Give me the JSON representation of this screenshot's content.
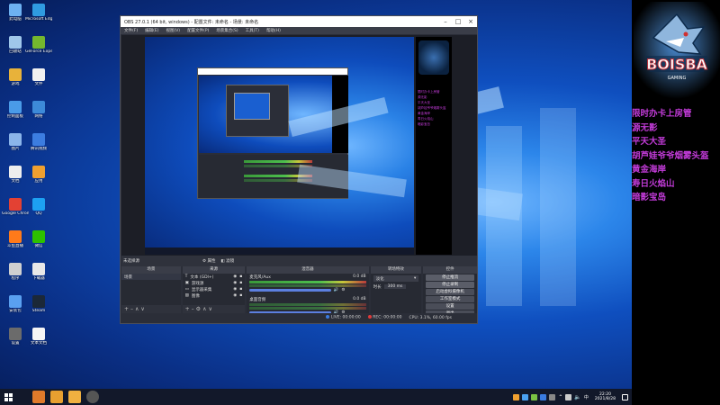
{
  "desktop": {
    "icons": [
      {
        "label": "此电脑",
        "color": "#6db1f2"
      },
      {
        "label": "Microsoft Edge",
        "color": "#2f9be0"
      },
      {
        "label": "回收站",
        "color": "#9fc7ea"
      },
      {
        "label": "GeForce Experience",
        "color": "#74b72e"
      },
      {
        "label": "游戏",
        "color": "#e8b23a"
      },
      {
        "label": "文件",
        "color": "#f1f1f1"
      },
      {
        "label": "控制面板",
        "color": "#4a9be8"
      },
      {
        "label": "网络",
        "color": "#3d8ad8"
      },
      {
        "label": "图片",
        "color": "#8bb5ea"
      },
      {
        "label": "腾讯视频",
        "color": "#3c7de0"
      },
      {
        "label": "文档",
        "color": "#eeeeee"
      },
      {
        "label": "应用",
        "color": "#f0a030"
      },
      {
        "label": "Google Chrome",
        "color": "#e34133"
      },
      {
        "label": "QQ",
        "color": "#1da1f2"
      },
      {
        "label": "斗鱼直播",
        "color": "#ff7a1a"
      },
      {
        "label": "微信",
        "color": "#2dc100"
      },
      {
        "label": "程序",
        "color": "#d0d0d0"
      },
      {
        "label": "下载器",
        "color": "#e8e8e8"
      },
      {
        "label": "安装包",
        "color": "#5aa0f0"
      },
      {
        "label": "Steam",
        "color": "#1b2838"
      },
      {
        "label": "设置",
        "color": "#6b6b6b"
      },
      {
        "label": "文本文档",
        "color": "#f5f5f5"
      }
    ]
  },
  "obs": {
    "title": "OBS 27.0.1 (64 bit, windows) - 配置文件: 未命名 - 场景: 未命名",
    "menu": [
      "文件(F)",
      "编辑(E)",
      "视图(V)",
      "配置文件(P)",
      "场景集合(S)",
      "工具(T)",
      "帮助(H)"
    ],
    "scene_label": "未选择源",
    "props_btn": "属性",
    "filters_btn": "滤镜",
    "docks": {
      "scenes": {
        "title": "场景",
        "items": [
          "场景"
        ]
      },
      "sources": {
        "title": "来源",
        "items": [
          "文本 (GDI+)",
          "游戏源",
          "显示器采集",
          "图像"
        ]
      },
      "mixer": {
        "title": "混音器",
        "channels": [
          {
            "name": "麦克风/Aux",
            "db": "0.0 dB"
          },
          {
            "name": "桌面音频",
            "db": "0.0 dB"
          }
        ]
      },
      "transitions": {
        "title": "转场特效",
        "type": "淡化",
        "duration_label": "时长",
        "duration": "300 ms"
      },
      "controls": {
        "title": "控件",
        "buttons": [
          "停止推流",
          "停止录制",
          "启动虚拟摄像机",
          "工作室模式",
          "设置",
          "退出"
        ]
      }
    },
    "status": {
      "live": "LIVE: 00:00:00",
      "rec": "REC: 00:00:00",
      "cpu": "CPU: 3.1%, 60.00 fps"
    }
  },
  "sidebar": {
    "logo_text": "BOISBA",
    "logo_sub": "GAMING",
    "list": [
      "限时办卡上房管",
      "源无影",
      "平天大圣",
      "胡芦娃爷爷烟雾头盔",
      "黄金海岸",
      "寿日火焰山",
      "暗影宝岛"
    ]
  },
  "taskbar": {
    "time": "22:20",
    "date": "2021/8/28",
    "ime": "中"
  },
  "colors": {
    "list_text": "#c23bd8",
    "taskbar": "#12182a",
    "obs_bg": "#2b2e38"
  }
}
